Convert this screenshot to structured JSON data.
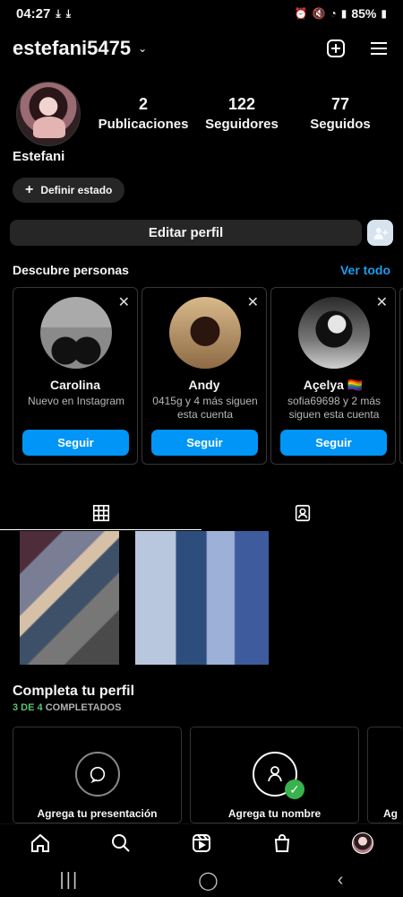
{
  "status": {
    "time": "04:27",
    "left_icons": [
      "download-icon",
      "download-icon"
    ],
    "right_icons": [
      "alarm-icon",
      "mute-icon",
      "wifi-icon",
      "signal-icon",
      "battery-icon"
    ],
    "battery": "85%"
  },
  "header": {
    "username": "estefani5475",
    "chevron": "⌄"
  },
  "profile": {
    "display_name": "Estefani",
    "stats": [
      {
        "value": "2",
        "label": "Publicaciones"
      },
      {
        "value": "122",
        "label": "Seguidores"
      },
      {
        "value": "77",
        "label": "Seguidos"
      }
    ],
    "status_button": "Definir estado",
    "edit_button": "Editar perfil"
  },
  "discover": {
    "title": "Descubre personas",
    "see_all": "Ver todo",
    "cards": [
      {
        "name": "Carolina",
        "subtitle": "Nuevo en Instagram",
        "button": "Seguir"
      },
      {
        "name": "Andy",
        "subtitle": "0415g y 4 más siguen esta cuenta",
        "button": "Seguir"
      },
      {
        "name": "Açelya 🏳️‍🌈",
        "subtitle": "sofia69698 y 2 más siguen esta cuenta",
        "button": "Seguir"
      }
    ]
  },
  "complete_profile": {
    "title": "Completa tu perfil",
    "progress_done": "3 DE 4",
    "progress_rest": " COMPLETADOS",
    "cards": [
      {
        "label": "Agrega tu presentación"
      },
      {
        "label": "Agrega tu nombre"
      },
      {
        "label": "Ag"
      }
    ]
  },
  "nav": {
    "items": [
      "home-icon",
      "search-icon",
      "reels-icon",
      "shop-icon",
      "profile-avatar"
    ]
  },
  "system_nav": {
    "recent": "|||",
    "home": "◯",
    "back": "‹"
  },
  "colors": {
    "accent": "#0095f6",
    "link": "#1d9bf0",
    "success": "#37b24d"
  }
}
